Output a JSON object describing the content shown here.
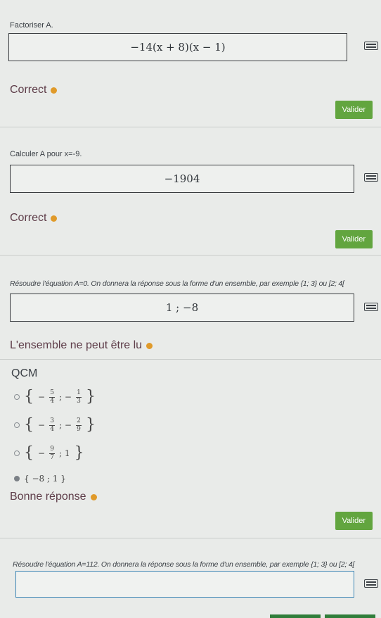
{
  "q1": {
    "label": "Factoriser A.",
    "answer": "−14(x + 8)(x − 1)",
    "feedback": "Correct",
    "validate": "Valider"
  },
  "q2": {
    "label": "Calculer A pour x=-9.",
    "answer": "−1904",
    "feedback": "Correct",
    "validate": "Valider"
  },
  "q3": {
    "label": "Résoudre l'équation A=0. On donnera la réponse sous la forme d'un ensemble, par exemple {1; 3} ou [2; 4[",
    "answer": "1 ; −8",
    "feedback": "L'ensemble ne peut être lu"
  },
  "qcm": {
    "title": "QCM",
    "options": [
      {
        "text": "{ −5/4 ; −1/3 }"
      },
      {
        "text": "{ −3/4 ; −2/9 }"
      },
      {
        "text": "{ −9/7 ; 1 }"
      },
      {
        "text": "{ −8 ; 1 }"
      }
    ],
    "selected": 3,
    "feedback": "Bonne réponse",
    "validate": "Valider"
  },
  "q4": {
    "label": "Résoudre l'équation A=112. On donnera la réponse sous la forme d'un ensemble, par exemple {1; 3} ou [2; 4[",
    "answer": ""
  },
  "colors": {
    "validate_bg": "#62a53f",
    "feedback_dot": "#e09a2a",
    "active_border": "#3f87b5"
  }
}
